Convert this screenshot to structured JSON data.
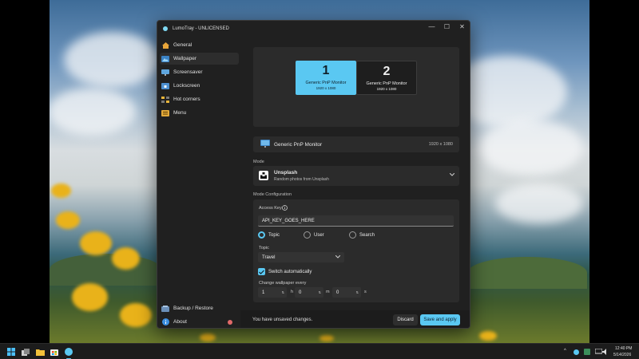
{
  "window": {
    "title": "LumoTray - UNLICENSED",
    "controls": [
      "—",
      "☐",
      "✕"
    ]
  },
  "sidebar": {
    "items": [
      {
        "label": "General",
        "icon": "home-icon"
      },
      {
        "label": "Wallpaper",
        "icon": "wallpaper-icon",
        "active": true
      },
      {
        "label": "Screensaver",
        "icon": "screensaver-icon"
      },
      {
        "label": "Lockscreen",
        "icon": "lockscreen-icon"
      },
      {
        "label": "Hot corners",
        "icon": "hot-corners-icon"
      },
      {
        "label": "Menu",
        "icon": "menu-icon"
      }
    ],
    "bottom_items": [
      {
        "label": "Backup / Restore",
        "icon": "backup-icon"
      },
      {
        "label": "About",
        "icon": "info-icon"
      }
    ]
  },
  "monitors": [
    {
      "number": "1",
      "name": "Generic PnP Monitor",
      "resolution": "1920 x 1080",
      "selected": true
    },
    {
      "number": "2",
      "name": "Generic PnP Monitor",
      "resolution": "1920 x 1080",
      "selected": false
    }
  ],
  "selected_monitor": {
    "name": "Generic PnP Monitor",
    "resolution": "1920 x 1080"
  },
  "mode": {
    "section_label": "Mode",
    "name": "Unsplash",
    "description": "Random photos from Unsplash"
  },
  "config": {
    "section_label": "Mode Configuration",
    "access_key_label": "Access Key",
    "access_key_value": "API_KEY_GOES_HERE",
    "radios": [
      {
        "label": "Topic",
        "selected": true
      },
      {
        "label": "User",
        "selected": false
      },
      {
        "label": "Search",
        "selected": false
      }
    ],
    "topic_label": "Topic",
    "topic_value": "Travel",
    "switch_label": "Switch automatically",
    "switch_checked": true,
    "interval_label": "Change wallpaper every",
    "hours": "1",
    "hours_unit": "h",
    "minutes": "0",
    "minutes_unit": "m",
    "seconds": "0",
    "seconds_unit": "s"
  },
  "footer": {
    "message": "You have unsaved changes.",
    "discard_label": "Discard",
    "save_label": "Save and apply"
  },
  "taskbar": {
    "time": "12:40 PM",
    "date": "5/14/2026"
  },
  "colors": {
    "accent": "#5ac8f2",
    "window_bg": "#202020",
    "card_bg": "#2b2b2b"
  }
}
